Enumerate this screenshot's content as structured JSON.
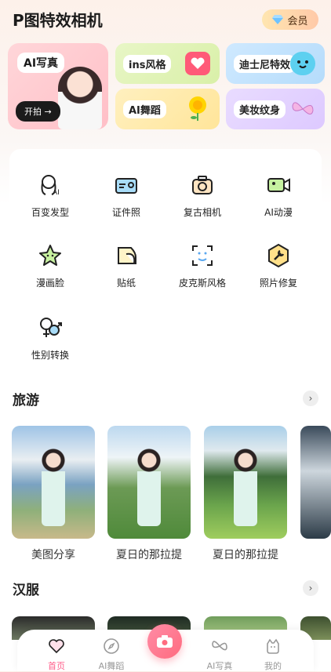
{
  "header": {
    "title": "P图特效相机",
    "vip_label": "会员"
  },
  "banners": {
    "ai_portrait": {
      "title": "AI写真",
      "cta": "开拍 →"
    },
    "ins": {
      "title": "ins风格"
    },
    "disney": {
      "title": "迪士尼特效"
    },
    "dance": {
      "title": "AI舞蹈"
    },
    "tattoo": {
      "title": "美妆纹身"
    }
  },
  "tools": [
    {
      "label": "百变发型",
      "icon": "hair-ai-icon"
    },
    {
      "label": "证件照",
      "icon": "id-card-icon"
    },
    {
      "label": "复古相机",
      "icon": "camera-icon"
    },
    {
      "label": "AI动漫",
      "icon": "video-camera-icon"
    },
    {
      "label": "漫画脸",
      "icon": "star-face-icon"
    },
    {
      "label": "贴纸",
      "icon": "sticker-icon"
    },
    {
      "label": "皮克斯风格",
      "icon": "face-scan-icon"
    },
    {
      "label": "照片修复",
      "icon": "wrench-icon"
    },
    {
      "label": "性别转换",
      "icon": "gender-icon"
    }
  ],
  "sections": {
    "travel": {
      "title": "旅游",
      "cards": [
        {
          "label": "美图分享"
        },
        {
          "label": "夏日的那拉提"
        },
        {
          "label": "夏日的那拉提"
        }
      ]
    },
    "hanfu": {
      "title": "汉服"
    }
  },
  "tabbar": [
    {
      "label": "首页",
      "icon": "heart-icon",
      "active": true
    },
    {
      "label": "AI舞蹈",
      "icon": "compass-icon",
      "active": false
    },
    {
      "label": "AI写真",
      "icon": "butterfly-icon",
      "active": false
    },
    {
      "label": "我的",
      "icon": "profile-icon",
      "active": false
    }
  ],
  "colors": {
    "accent": "#ff5d8a",
    "camera": "#ff6b7f"
  }
}
